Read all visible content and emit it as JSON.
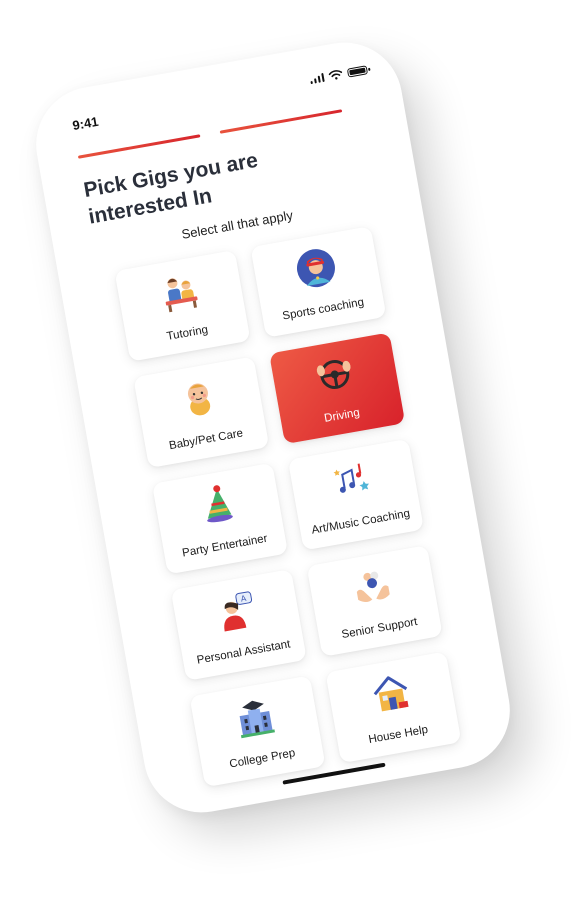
{
  "status_bar": {
    "time": "9:41"
  },
  "progress": {
    "steps_total": 2,
    "steps_completed": 2
  },
  "header": {
    "title": "Pick  Gigs you are\ninterested In",
    "subtitle": "Select all that apply"
  },
  "gigs": [
    {
      "label": "Tutoring",
      "icon": "tutoring-icon",
      "selected": false
    },
    {
      "label": "Sports coaching",
      "icon": "sports-coach-icon",
      "selected": false
    },
    {
      "label": "Baby/Pet Care",
      "icon": "baby-icon",
      "selected": false
    },
    {
      "label": "Driving",
      "icon": "steering-wheel-icon",
      "selected": true
    },
    {
      "label": "Party Entertainer",
      "icon": "party-hat-icon",
      "selected": false
    },
    {
      "label": "Art/Music Coaching",
      "icon": "music-notes-icon",
      "selected": false
    },
    {
      "label": "Personal Assistant",
      "icon": "assistant-icon",
      "selected": false
    },
    {
      "label": "Senior Support",
      "icon": "helping-hands-icon",
      "selected": false
    },
    {
      "label": "College Prep",
      "icon": "college-building-icon",
      "selected": false
    },
    {
      "label": "House Help",
      "icon": "house-icon",
      "selected": false
    }
  ],
  "colors": {
    "accent": "#e0302f",
    "accent_light": "#ee5a45",
    "text_dark": "#2a2f3a"
  }
}
